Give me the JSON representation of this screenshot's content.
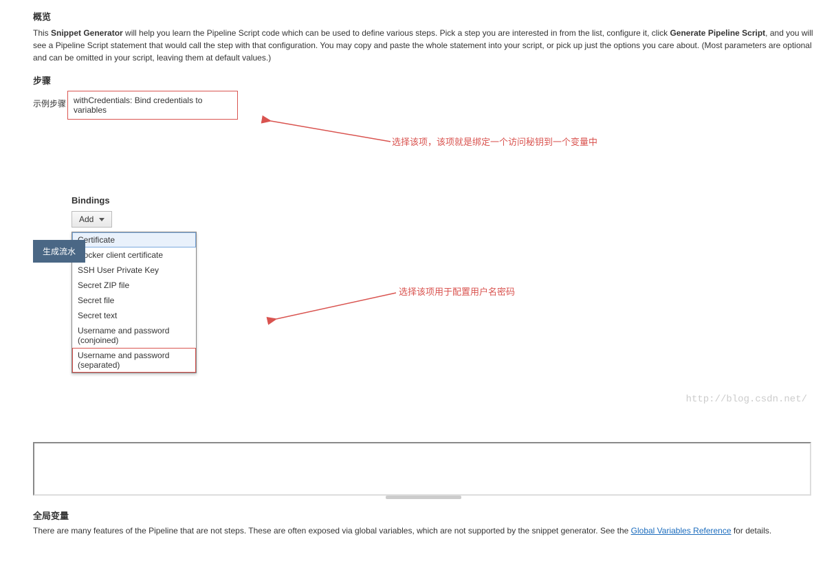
{
  "overview": {
    "title": "概览",
    "text_prefix": "This ",
    "snippet_generator": "Snippet Generator",
    "text_mid": " will help you learn the Pipeline Script code which can be used to define various steps. Pick a step you are interested in from the list, configure it, click ",
    "generate_pipeline": "Generate Pipeline Script",
    "text_suffix": ", and you will see a Pipeline Script statement that would call the step with that configuration. You may copy and paste the whole statement into your script, or pick up just the options you care about. (Most parameters are optional and can be omitted in your script, leaving them at default values.)"
  },
  "steps": {
    "title": "步骤",
    "sample_label": "示例步骤",
    "selected": "withCredentials: Bind credentials to variables",
    "annotation1": "选择该项，该项就是绑定一个访问秘钥到一个变量中"
  },
  "bindings": {
    "title": "Bindings",
    "add_label": "Add",
    "options": [
      "Certificate",
      "Docker client certificate",
      "SSH User Private Key",
      "Secret ZIP file",
      "Secret file",
      "Secret text",
      "Username and password (conjoined)",
      "Username and password (separated)"
    ],
    "annotation2": "选择该项用于配置用户名密码"
  },
  "generate": {
    "button": "生成流水"
  },
  "globals": {
    "title": "全局变量",
    "text_prefix": "There are many features of the Pipeline that are not steps. These are often exposed via global variables, which are not supported by the snippet generator. See the ",
    "link": "Global Variables Reference",
    "text_suffix": " for details."
  },
  "watermark": "http://blog.csdn.net/"
}
